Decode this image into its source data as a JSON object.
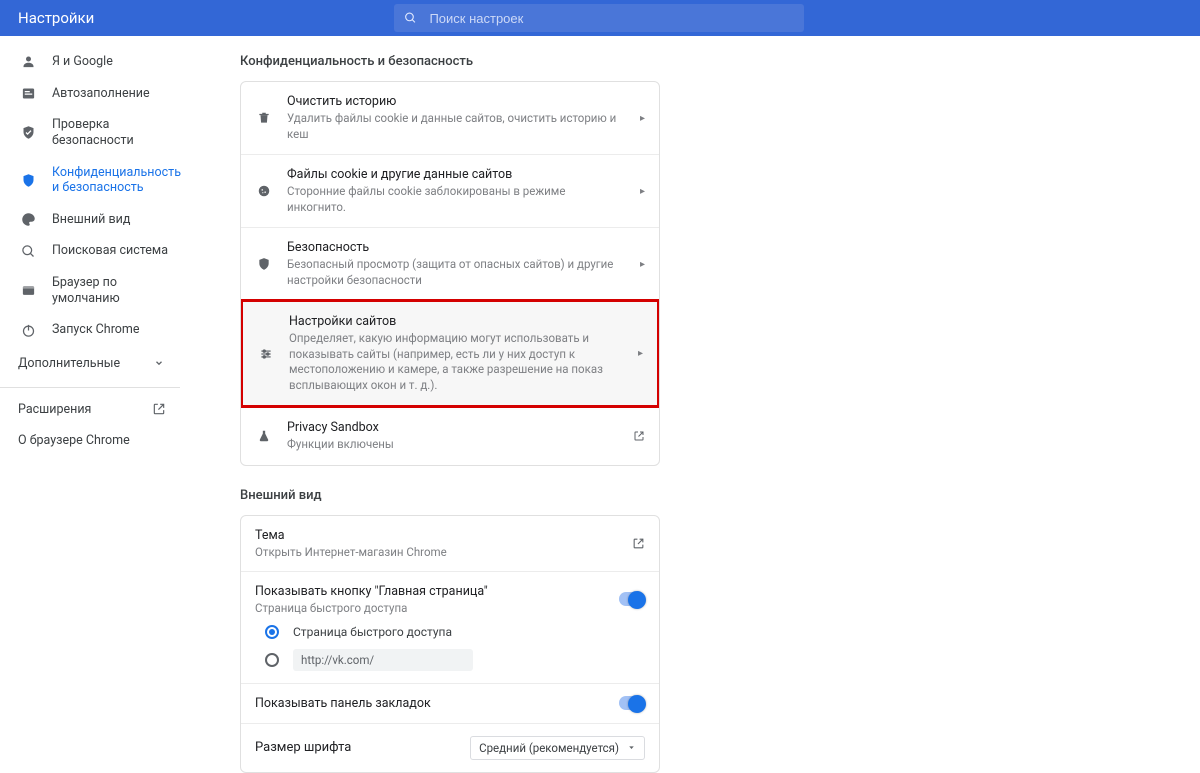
{
  "header": {
    "title": "Настройки",
    "search_placeholder": "Поиск настроек"
  },
  "sidebar": {
    "items": [
      {
        "label": "Я и Google"
      },
      {
        "label": "Автозаполнение"
      },
      {
        "label": "Проверка безопасности"
      },
      {
        "label": "Конфиденциальность и безопасность"
      },
      {
        "label": "Внешний вид"
      },
      {
        "label": "Поисковая система"
      },
      {
        "label": "Браузер по умолчанию"
      },
      {
        "label": "Запуск Chrome"
      }
    ],
    "advanced": "Дополнительные",
    "extensions": "Расширения",
    "about": "О браузере Chrome"
  },
  "privacy": {
    "title": "Конфиденциальность и безопасность",
    "rows": [
      {
        "title": "Очистить историю",
        "sub": "Удалить файлы cookie и данные сайтов, очистить историю и кеш"
      },
      {
        "title": "Файлы cookie и другие данные сайтов",
        "sub": "Сторонние файлы cookie заблокированы в режиме инкогнито."
      },
      {
        "title": "Безопасность",
        "sub": "Безопасный просмотр (защита от опасных сайтов) и другие настройки безопасности"
      },
      {
        "title": "Настройки сайтов",
        "sub": "Определяет, какую информацию могут использовать и показывать сайты (например, есть ли у них доступ к местоположению и камере, а также разрешение на показ всплывающих окон и т. д.)."
      },
      {
        "title": "Privacy Sandbox",
        "sub": "Функции включены"
      }
    ]
  },
  "appearance": {
    "title": "Внешний вид",
    "theme_title": "Тема",
    "theme_sub": "Открыть Интернет-магазин Chrome",
    "home_title": "Показывать кнопку \"Главная страница\"",
    "home_sub": "Страница быстрого доступа",
    "radio1": "Страница быстрого доступа",
    "url_value": "http://vk.com/",
    "bookmarks": "Показывать панель закладок",
    "font_label": "Размер шрифта",
    "font_value": "Средний (рекомендуется)"
  }
}
